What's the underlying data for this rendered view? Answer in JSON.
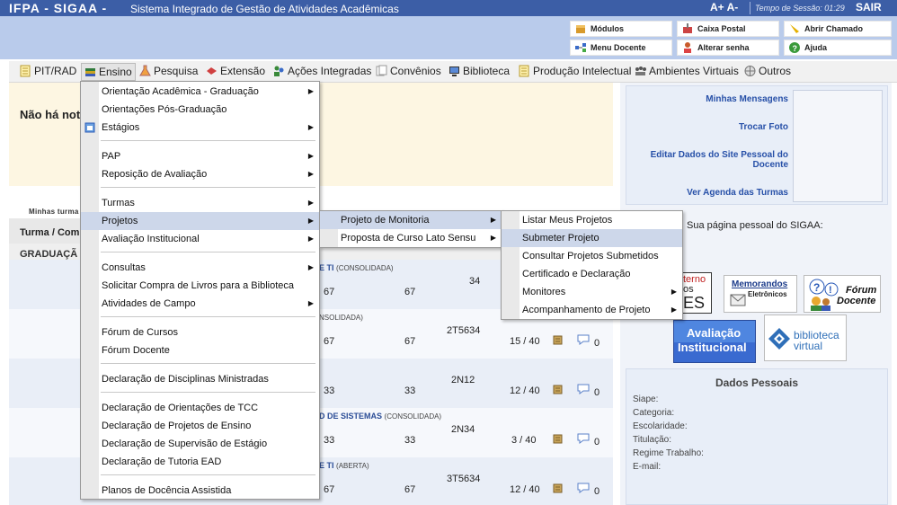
{
  "topbar": {
    "brand": "IFPA - SIGAA -",
    "system_name": "Sistema Integrado de Gestão de Atividades Acadêmicas",
    "font_controls": "A+ A-",
    "session_label": "Tempo de Sessão: 01:29",
    "logout": "SAIR"
  },
  "header": {
    "modulos": "Módulos",
    "caixa_postal": "Caixa Postal",
    "abrir_chamado": "Abrir Chamado",
    "menu_docente": "Menu Docente",
    "alterar_senha": "Alterar senha",
    "ajuda": "Ajuda"
  },
  "menubar": {
    "items": [
      "PIT/RAD",
      "Ensino",
      "Pesquisa",
      "Extensão",
      "Ações Integradas",
      "Convênios",
      "Biblioteca",
      "Produção Intelectual",
      "Ambientes Virtuais",
      "Outros"
    ]
  },
  "main": {
    "notice": "Não há not",
    "minhas_turmas_label": "Minhas turma",
    "turma_header": "Turma / Com",
    "graduacao_header": "GRADUAÇÃ",
    "rows": [
      {
        "name": "E TI",
        "status": "(CONSOLIDADA)",
        "c1": "67",
        "c2": "67",
        "code": "34",
        "vagas": "",
        "count": ""
      },
      {
        "name": "",
        "status": "NSOLIDADA)",
        "c1": "67",
        "c2": "67",
        "code": "2T5634",
        "vagas": "15 / 40",
        "count": "0"
      },
      {
        "name": "",
        "status": "",
        "c1": "33",
        "c2": "33",
        "code": "2N12",
        "vagas": "12 / 40",
        "count": "0"
      },
      {
        "name": "D DE SISTEMAS",
        "status": "(CONSOLIDADA)",
        "c1": "33",
        "c2": "33",
        "code": "2N34",
        "vagas": "3 / 40",
        "count": "0"
      },
      {
        "name": "E TI",
        "status": "(ABERTA)",
        "c1": "67",
        "c2": "67",
        "code": "3T5634",
        "vagas": "12 / 40",
        "count": "0"
      }
    ]
  },
  "right": {
    "minhas_mensagens": "Minhas Mensagens",
    "trocar_foto": "Trocar Foto",
    "editar_site": "Editar Dados do Site Pessoal do Docente",
    "ver_agenda": "Ver Agenda das Turmas",
    "portal_text": "Sua página pessoal do SIGAA:",
    "logo_interno_1": "terno",
    "logo_interno_2": "os",
    "logo_interno_3": "ES",
    "logo_memorandos_1": "Memorandos",
    "logo_memorandos_2": "Eletrônicos",
    "logo_forum_1": "Fórum",
    "logo_forum_2": "Docente",
    "logo_avaliacao_1": "Avaliação",
    "logo_avaliacao_2": "Institucional",
    "logo_biblioteca_1": "biblioteca",
    "logo_biblioteca_2": "virtual",
    "dados_title": "Dados Pessoais",
    "dados_labels": [
      "Siape:",
      "Categoria:",
      "Escolaridade:",
      "Titulação:",
      "Regime Trabalho:",
      "E-mail:"
    ]
  },
  "menu_ensino": {
    "items": [
      "Orientação Acadêmica - Graduação",
      "Orientações Pós-Graduação",
      "Estágios",
      "PAP",
      "Reposição de Avaliação",
      "Turmas",
      "Projetos",
      "Avaliação Institucional",
      "Consultas",
      "Solicitar Compra de Livros para a Biblioteca",
      "Atividades de Campo",
      "Fórum de Cursos",
      "Fórum Docente",
      "Declaração de Disciplinas Ministradas",
      "Declaração de Orientações de TCC",
      "Declaração de Projetos de Ensino",
      "Declaração de Supervisão de Estágio",
      "Declaração de Tutoria EAD",
      "Planos de Docência Assistida"
    ]
  },
  "menu_projetos": {
    "items": [
      "Projeto de Monitoria",
      "Proposta de Curso Lato Sensu"
    ]
  },
  "menu_monitoria": {
    "items": [
      "Listar Meus Projetos",
      "Submeter Projeto",
      "Consultar Projetos Submetidos",
      "Certificado e Declaração",
      "Monitores",
      "Acompanhamento de Projeto"
    ]
  },
  "colors": {
    "topbar": "#3c5ea6",
    "header": "#b9cbeb",
    "highlight": "#cdd7ea",
    "link": "#2750a8"
  }
}
